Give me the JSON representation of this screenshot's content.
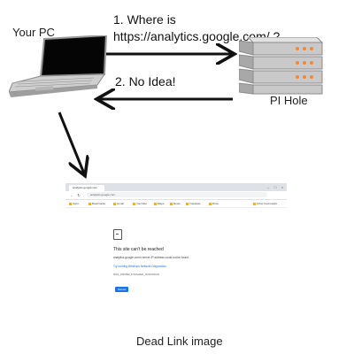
{
  "labels": {
    "your_pc": "Your PC",
    "step1_line1": "1. Where is",
    "step1_line2": "https://analytics.google.com/ ?",
    "step2": "2. No Idea!",
    "pi_hole": "PI Hole",
    "caption": "Dead Link image"
  },
  "browser": {
    "tab_title": "analytics.google.com",
    "url": "analytics.google.com",
    "bookmarks": [
      "Apps",
      "Bookmarks",
      "Gmail",
      "YouTube",
      "Maps",
      "News",
      "Translate",
      "Drive",
      "Other bookmarks"
    ],
    "error_title": "This site can't be reached",
    "error_detail": "analytics.google.com's server IP address could not be found.",
    "error_link": "Try running Windows Network Diagnostics.",
    "error_code": "DNS_PROBE_FINISHED_NXDOMAIN",
    "reload_label": "Reload"
  },
  "colors": {
    "arrow": "#111111",
    "server_led": "#f08a3c",
    "server_body": "#c8c8c8",
    "link": "#1a73e8"
  }
}
